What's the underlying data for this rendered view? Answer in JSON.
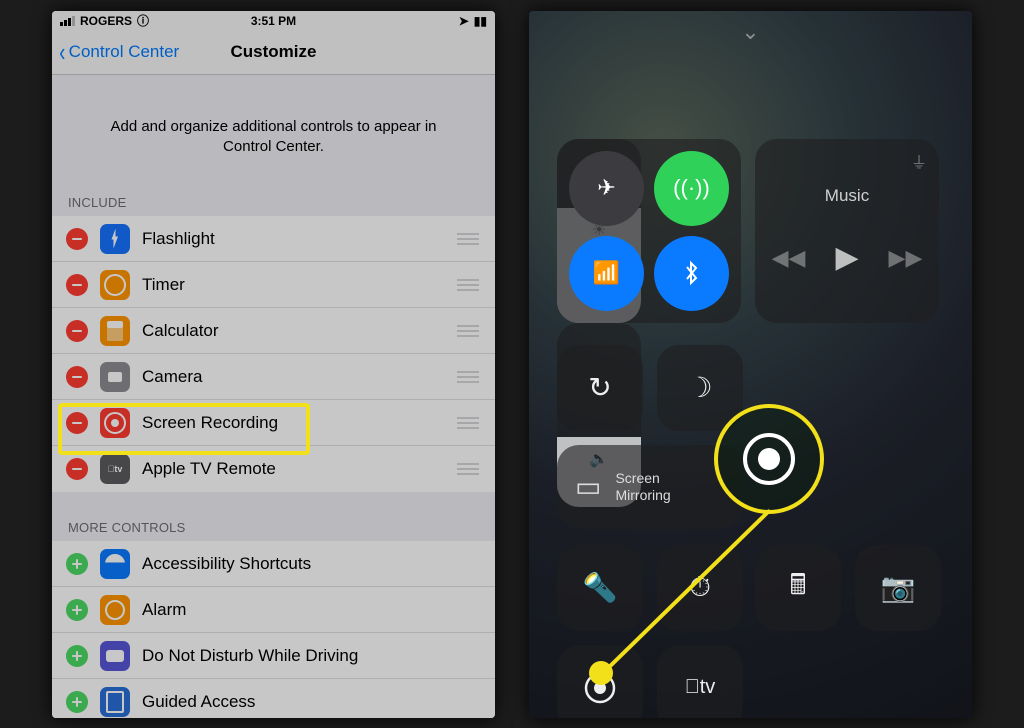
{
  "left": {
    "statusbar": {
      "carrier": "ROGERS",
      "time": "3:51 PM"
    },
    "nav": {
      "back": "Control Center",
      "title": "Customize"
    },
    "description": "Add and organize additional controls to appear in Control Center.",
    "sections": {
      "include_header": "INCLUDE",
      "include": [
        {
          "name": "Flashlight"
        },
        {
          "name": "Timer"
        },
        {
          "name": "Calculator"
        },
        {
          "name": "Camera"
        },
        {
          "name": "Screen Recording"
        },
        {
          "name": "Apple TV Remote"
        }
      ],
      "more_header": "MORE CONTROLS",
      "more": [
        {
          "name": "Accessibility Shortcuts"
        },
        {
          "name": "Alarm"
        },
        {
          "name": "Do Not Disturb While Driving"
        },
        {
          "name": "Guided Access"
        }
      ]
    }
  },
  "right": {
    "music_label": "Music",
    "mirror_label": "Screen\nMirroring",
    "atv_label": "tv"
  }
}
